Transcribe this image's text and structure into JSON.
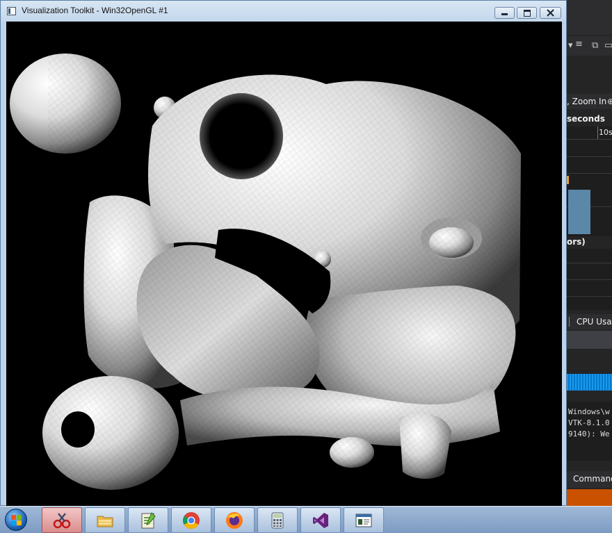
{
  "window": {
    "title": "Visualization Toolkit - Win32OpenGL #1"
  },
  "background_ide": {
    "zoom_label": ", Zoom In",
    "seconds_label": "seconds",
    "timeline_tick": "10s",
    "section_label": "ors)",
    "cpu_tab": "CPU Usag",
    "output_lines": [
      "Windows\\w",
      "VTK-8.1.0",
      "9140): We"
    ],
    "command_tab": "Command",
    "accent_blue": "#007acc",
    "accent_orange": "#ca5100"
  },
  "taskbar": {
    "items": [
      {
        "name": "snipping-tool",
        "icon": "scissors-icon",
        "active": true
      },
      {
        "name": "file-explorer",
        "icon": "folder-icon",
        "active": false
      },
      {
        "name": "notepad-plus-plus",
        "icon": "notepad-icon",
        "active": false
      },
      {
        "name": "chrome",
        "icon": "chrome-icon",
        "active": false
      },
      {
        "name": "firefox",
        "icon": "firefox-icon",
        "active": false
      },
      {
        "name": "calculator",
        "icon": "calculator-icon",
        "active": false
      },
      {
        "name": "visual-studio",
        "icon": "visual-studio-icon",
        "active": false
      },
      {
        "name": "vtk-app",
        "icon": "window-app-icon",
        "active": false
      }
    ]
  }
}
